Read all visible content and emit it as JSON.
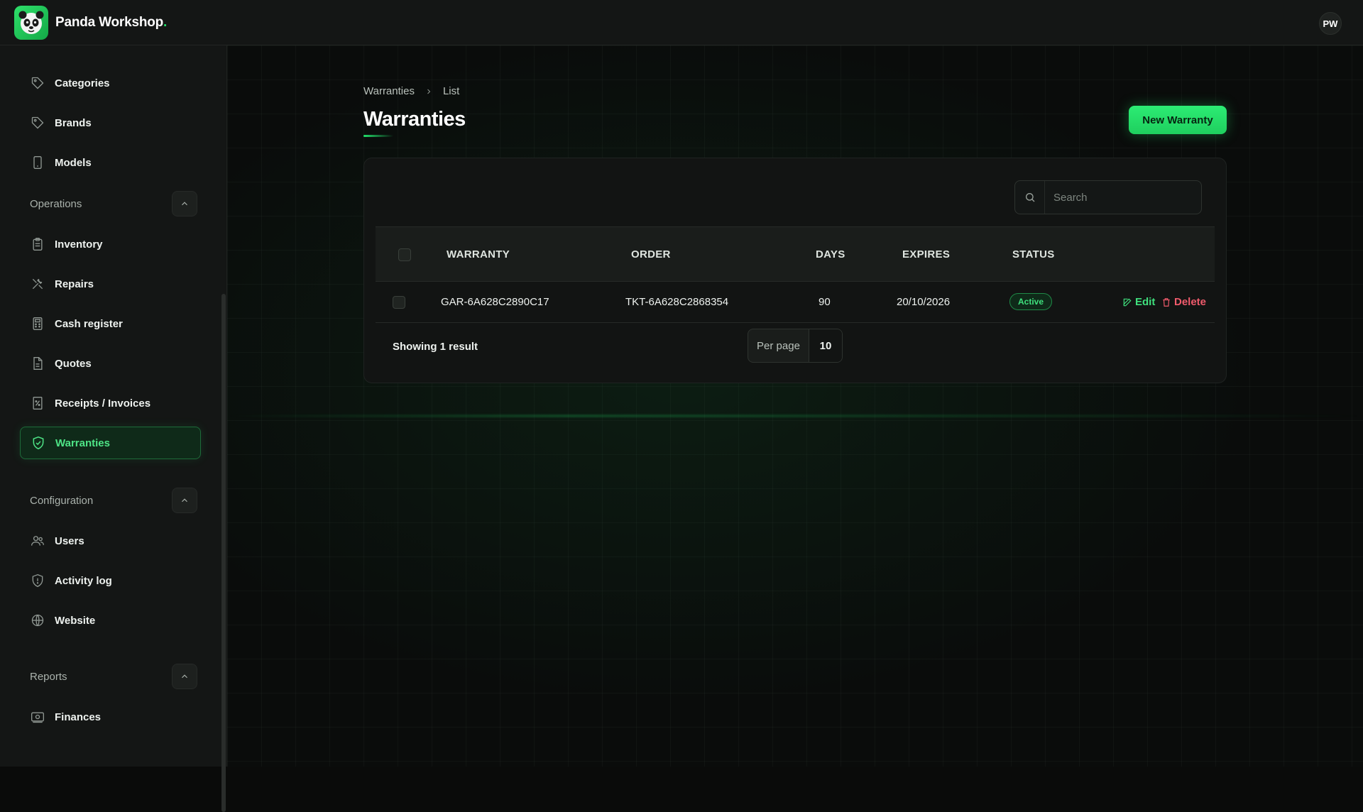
{
  "app": {
    "name": "Panda Workshop",
    "name_suffix": ".",
    "user_initials": "PW",
    "accent": "#22e06a"
  },
  "sidebar": {
    "items_top": [
      {
        "label": "Categories",
        "icon": "tag-icon"
      },
      {
        "label": "Brands",
        "icon": "tag-icon"
      },
      {
        "label": "Models",
        "icon": "phone-icon"
      }
    ],
    "sections": [
      {
        "label": "Operations",
        "items": [
          {
            "label": "Inventory",
            "icon": "clipboard-icon"
          },
          {
            "label": "Repairs",
            "icon": "tools-icon"
          },
          {
            "label": "Cash register",
            "icon": "calculator-icon"
          },
          {
            "label": "Quotes",
            "icon": "document-icon"
          },
          {
            "label": "Receipts / Invoices",
            "icon": "receipt-icon"
          },
          {
            "label": "Warranties",
            "icon": "shield-check-icon",
            "active": true
          }
        ]
      },
      {
        "label": "Configuration",
        "items": [
          {
            "label": "Users",
            "icon": "users-icon"
          },
          {
            "label": "Activity log",
            "icon": "shield-icon"
          },
          {
            "label": "Website",
            "icon": "globe-icon"
          }
        ]
      },
      {
        "label": "Reports",
        "items": [
          {
            "label": "Finances",
            "icon": "money-icon"
          }
        ]
      }
    ]
  },
  "breadcrumb": {
    "parent": "Warranties",
    "current": "List"
  },
  "page": {
    "title": "Warranties",
    "new_button": "New Warranty"
  },
  "table": {
    "search_placeholder": "Search",
    "columns": [
      "WARRANTY",
      "ORDER",
      "DAYS",
      "EXPIRES",
      "STATUS"
    ],
    "rows": [
      {
        "warranty": "GAR-6A628C2890C17",
        "order": "TKT-6A628C2868354",
        "days": "90",
        "expires": "20/10/2026",
        "status": "Active"
      }
    ],
    "actions": {
      "edit": "Edit",
      "delete": "Delete"
    },
    "footer": {
      "summary": "Showing 1 result",
      "per_page_label": "Per page",
      "per_page_value": "10"
    }
  }
}
